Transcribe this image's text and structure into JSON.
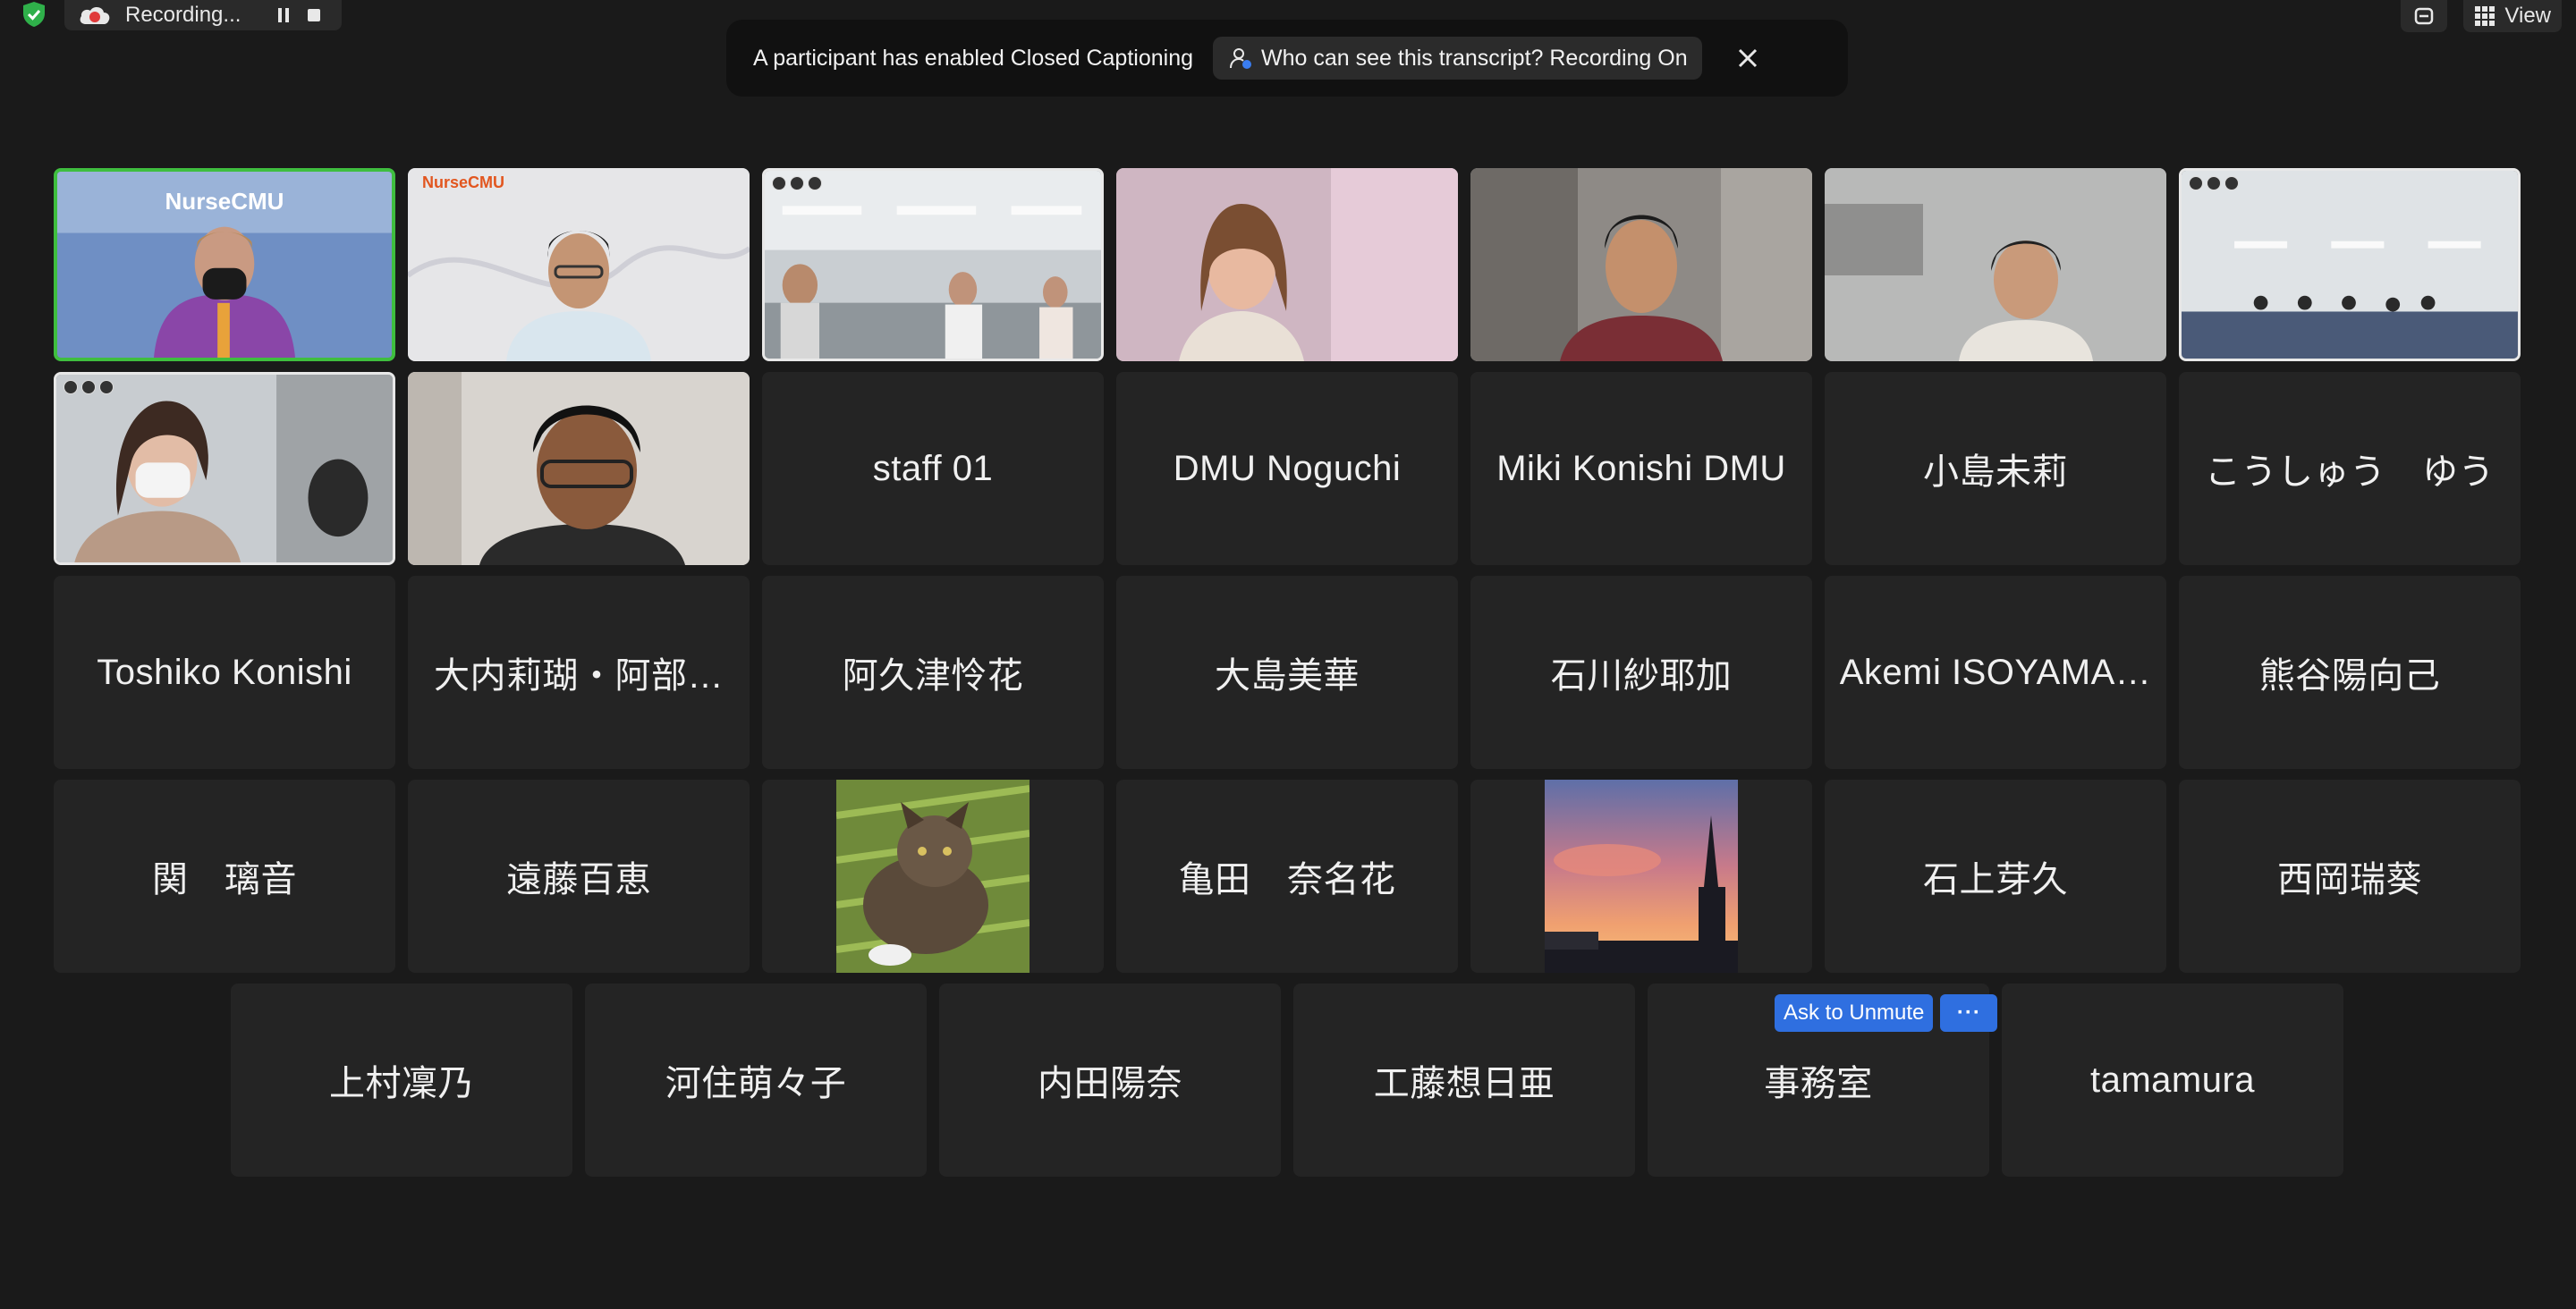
{
  "recording": {
    "status": "Recording..."
  },
  "top_right": {
    "view_label": "View"
  },
  "notification": {
    "message": "A participant has enabled Closed Captioning",
    "who_label": "Who can see this transcript? Recording On"
  },
  "video_tiles": {
    "t1": {
      "overlay": "NurseCMU"
    },
    "t2": {
      "overlay": "NurseCMU"
    }
  },
  "participants": [
    "staff 01",
    "DMU Noguchi",
    "Miki Konishi DMU",
    "小島未莉",
    "こうしゅう　ゆう",
    "Toshiko Konishi",
    "大内莉瑚・阿部…",
    "阿久津怜花",
    "大島美華",
    "石川紗耶加",
    "Akemi ISOYAMA…",
    "熊谷陽向己",
    "関　璃音",
    "遠藤百恵",
    "亀田　奈名花",
    "石上芽久",
    "西岡瑞葵",
    "上村凜乃",
    "河住萌々子",
    "内田陽奈",
    "工藤想日亜",
    "事務室",
    "tamamura"
  ],
  "hover_controls": {
    "ask_to_unmute": "Ask to Unmute",
    "more": "···"
  },
  "colors": {
    "background": "#1a1a1a",
    "tile": "#242424",
    "active_speaker": "#3fbe3f",
    "accent_button": "#2f6fe0"
  }
}
